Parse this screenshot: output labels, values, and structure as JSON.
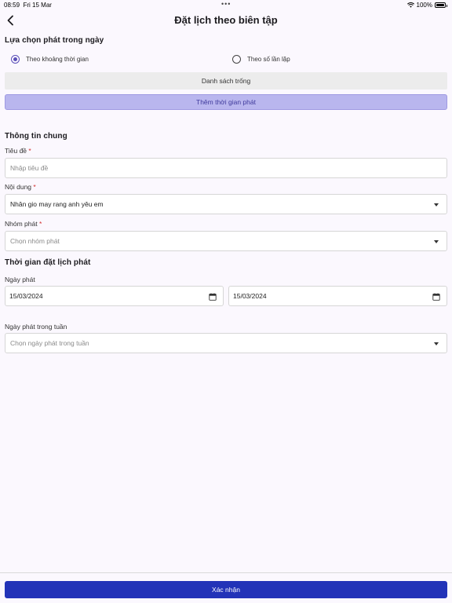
{
  "status_bar": {
    "time": "08:59",
    "date": "Fri 15 Mar",
    "dots": "•••",
    "battery": "100%"
  },
  "header": {
    "title": "Đặt lịch theo biên tập"
  },
  "daily_option": {
    "title": "Lựa chọn phát trong ngày",
    "options": [
      {
        "label": "Theo khoảng thời gian",
        "selected": true
      },
      {
        "label": "Theo số lần lặp",
        "selected": false
      }
    ],
    "empty_list": "Danh sách trống",
    "add_time_label": "Thêm thời gian phát"
  },
  "general_info": {
    "title": "Thông tin chung",
    "title_label": "Tiêu đề",
    "title_placeholder": "Nhập tiêu đề",
    "content_label": "Nội dung",
    "content_value": "Nhân gio may rang anh yêu em",
    "group_label": "Nhóm phát",
    "group_placeholder": "Chọn nhóm phát",
    "required_mark": "*"
  },
  "schedule": {
    "title": "Thời gian đặt lịch phát",
    "date_label": "Ngày phát",
    "start_date": "15/03/2024",
    "end_date": "15/03/2024",
    "weekday_label": "Ngày phát trong tuần",
    "weekday_placeholder": "Chọn ngày phát trong tuần"
  },
  "footer": {
    "confirm_label": "Xác nhận"
  },
  "colors": {
    "accent": "#5a4fb8",
    "primary_button": "#2233b8",
    "add_button_bg": "#b9b6ee",
    "required": "#d32f2f"
  }
}
